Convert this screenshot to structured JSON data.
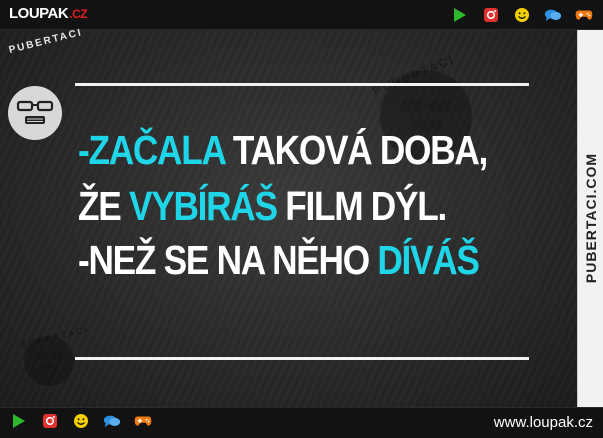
{
  "header": {
    "logo": {
      "name": "LOUPAK",
      "tld": ".CZ"
    },
    "icons": [
      "play-icon",
      "instagram-icon",
      "smiley-icon",
      "chat-icon",
      "gamepad-icon"
    ]
  },
  "meme": {
    "lines": [
      [
        {
          "text": "-ZAČALA",
          "color": "cyan"
        },
        {
          "text": " TAKOVÁ DOBA,",
          "color": "white"
        }
      ],
      [
        {
          "text": "ŽE ",
          "color": "white"
        },
        {
          "text": "VYBÍRÁŠ",
          "color": "cyan"
        },
        {
          "text": " FILM DÝL.",
          "color": "white"
        }
      ],
      [
        {
          "text": "-NEŽ SE NA NĚHO ",
          "color": "white"
        },
        {
          "text": "DÍVÁŠ",
          "color": "cyan"
        }
      ]
    ],
    "stamp_text": "PUBERTACI"
  },
  "sidebar": {
    "text": "PUBERTACI.COM"
  },
  "footer": {
    "url": "www.loupak.cz",
    "icons": [
      "play-icon",
      "instagram-icon",
      "smiley-icon",
      "chat-icon",
      "gamepad-icon"
    ]
  },
  "colors": {
    "cyan": "#1fd6e8",
    "white": "#ffffff",
    "play": "#2db82d",
    "instagram": "#e03030",
    "smiley": "#f5d000",
    "chat": "#2d8fe0",
    "gamepad": "#f07a10"
  }
}
